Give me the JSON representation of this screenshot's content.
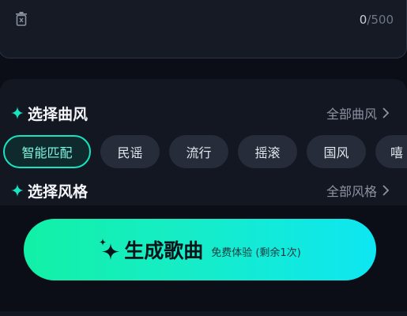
{
  "lyrics_input": {
    "count_current": "0",
    "count_max": "/500"
  },
  "style_section": {
    "title": "选择曲风",
    "all_link": "全部曲风",
    "chips": [
      {
        "label": "智能匹配",
        "active": true
      },
      {
        "label": "民谣",
        "active": false
      },
      {
        "label": "流行",
        "active": false
      },
      {
        "label": "摇滚",
        "active": false
      },
      {
        "label": "国风",
        "active": false
      },
      {
        "label": "嘻",
        "active": false
      }
    ]
  },
  "genre_section": {
    "title": "选择风格",
    "all_link": "全部风格"
  },
  "generate": {
    "label": "生成歌曲",
    "note": "免费体验 (剩余1次)"
  },
  "colors": {
    "accent": "#18e3c1",
    "background": "#0b0e16",
    "panel": "#121722",
    "chip": "#262c39"
  },
  "icons": {
    "trash": "trash-icon",
    "spark": "sparkle-icon",
    "chevron": "chevron-right-icon"
  }
}
